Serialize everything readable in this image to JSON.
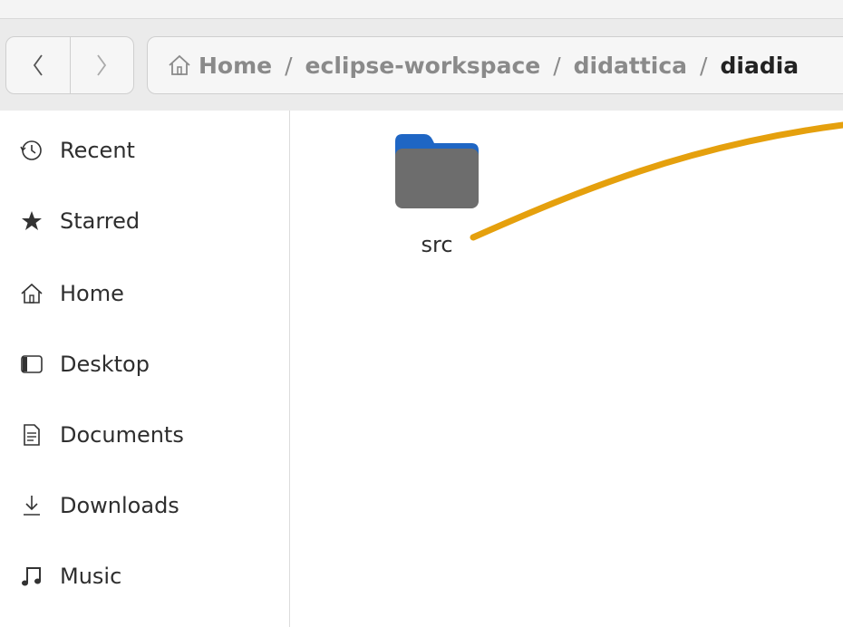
{
  "header": {
    "back_icon": "chevron-left-icon",
    "forward_icon": "chevron-right-icon",
    "breadcrumb": {
      "home_icon": "home-icon",
      "items": [
        "Home",
        "eclipse-workspace",
        "didattica",
        "diadia"
      ],
      "separator": "/"
    }
  },
  "sidebar": {
    "items": [
      {
        "label": "Recent",
        "icon": "clock-icon"
      },
      {
        "label": "Starred",
        "icon": "star-icon"
      },
      {
        "label": "Home",
        "icon": "home-icon"
      },
      {
        "label": "Desktop",
        "icon": "desktop-icon"
      },
      {
        "label": "Documents",
        "icon": "document-icon"
      },
      {
        "label": "Downloads",
        "icon": "download-icon"
      },
      {
        "label": "Music",
        "icon": "music-note-icon"
      }
    ]
  },
  "content": {
    "items": [
      {
        "name": "src",
        "icon": "folder-icon"
      }
    ]
  },
  "colors": {
    "folder_body": "#6d6d6d",
    "folder_tab": "#1f66c4",
    "annotation": "#e5a00d",
    "header_bg": "#ebebeb"
  }
}
